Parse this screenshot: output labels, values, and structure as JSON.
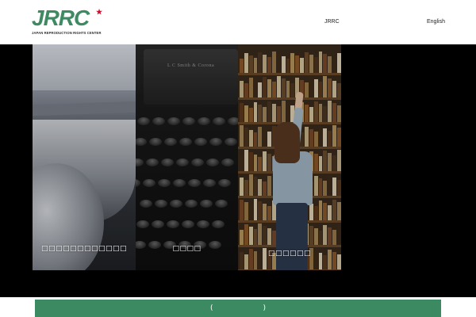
{
  "header": {
    "logo": {
      "mark": "JRRC",
      "subtitle": "JAPAN REPRODUCTION RIGHTS CENTER"
    },
    "nav": [
      {
        "label": "JRRC"
      },
      {
        "label": "English"
      }
    ]
  },
  "hero": {
    "panels": [
      {
        "caption": "□□□□□□□□□□□□",
        "image": "typewriter-paper-photo"
      },
      {
        "caption": "□□□□",
        "image": "typewriter-keys-photo",
        "brand_text": "L C Smith & Corona"
      },
      {
        "caption": "□□□□□□",
        "image": "library-bookshelf-photo"
      }
    ]
  },
  "footer_bar": {
    "label": "(　　　　　　　)"
  },
  "colors": {
    "brand_green": "#3c8a62",
    "logo_red": "#c8102e",
    "hero_background": "#000000"
  }
}
